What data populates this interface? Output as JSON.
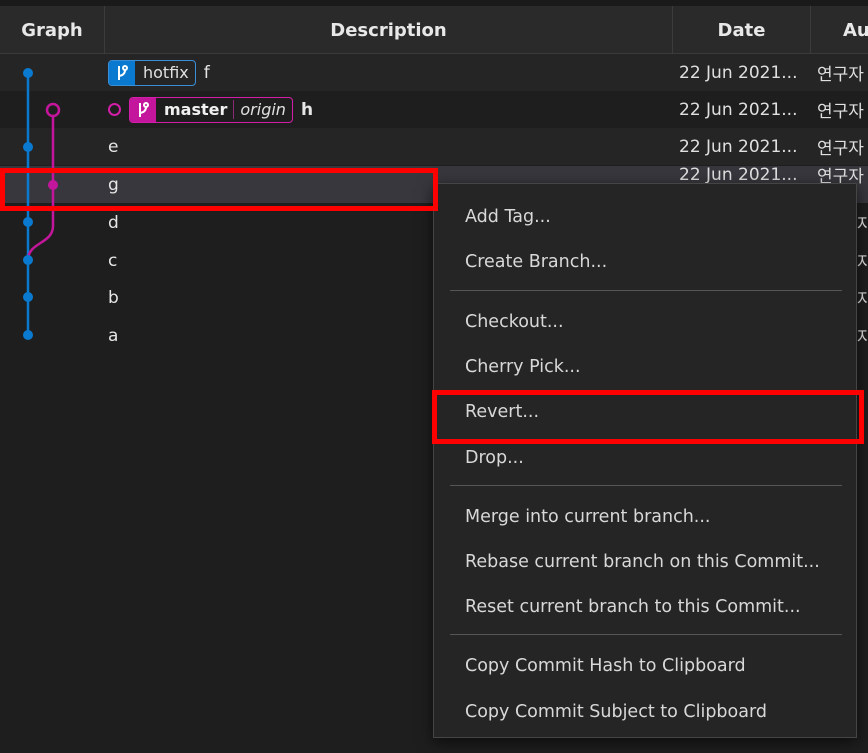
{
  "columns": {
    "graph": "Graph",
    "description": "Description",
    "date": "Date",
    "author": "Au"
  },
  "refs": {
    "hotfix": "hotfix",
    "master": "master",
    "origin": "origin"
  },
  "rows": [
    {
      "subject": "f",
      "date": "22 Jun 2021...",
      "author": "연구자"
    },
    {
      "subject": "h",
      "date": "22 Jun 2021...",
      "author": "연구자"
    },
    {
      "subject": "e",
      "date": "22 Jun 2021...",
      "author": "연구자"
    },
    {
      "subject": "g",
      "date": "22 Jun 2021...",
      "author": "연구자"
    },
    {
      "subject": "d",
      "date": "",
      "author": "자"
    },
    {
      "subject": "c",
      "date": "",
      "author": "자"
    },
    {
      "subject": "b",
      "date": "",
      "author": "자"
    },
    {
      "subject": "a",
      "date": "",
      "author": "자"
    }
  ],
  "menu": {
    "add_tag": "Add Tag...",
    "create_branch": "Create Branch...",
    "checkout": "Checkout...",
    "cherry_pick": "Cherry Pick...",
    "revert": "Revert...",
    "drop": "Drop...",
    "merge": "Merge into current branch...",
    "rebase": "Rebase current branch on this Commit...",
    "reset": "Reset current branch to this Commit...",
    "copy_hash": "Copy Commit Hash to Clipboard",
    "copy_subject": "Copy Commit Subject to Clipboard"
  },
  "colors": {
    "branch_blue": "#0a7ad0",
    "branch_magenta": "#c4169c",
    "highlight_red": "#ff0000"
  }
}
